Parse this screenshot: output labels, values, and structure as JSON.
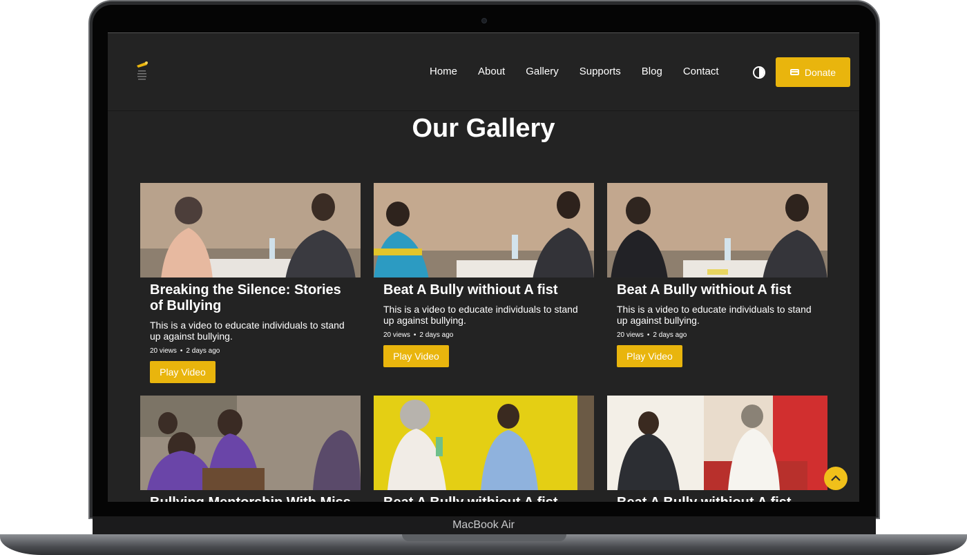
{
  "device": {
    "label": "MacBook Air"
  },
  "nav": {
    "items": [
      "Home",
      "About",
      "Gallery",
      "Supports",
      "Blog",
      "Contact"
    ],
    "donate_label": "Donate"
  },
  "page": {
    "title": "Our Gallery"
  },
  "colors": {
    "accent": "#e9b50d",
    "background": "#232323",
    "text": "#ffffff"
  },
  "videos": [
    {
      "title": "Breaking the Silence: Stories of Bullying",
      "description": "This is a video to educate individuals to stand up against bullying.",
      "views": "20 views",
      "age": "2 days ago",
      "button": "Play Video"
    },
    {
      "title": "Beat A Bully withiout A fist",
      "description": "This is a video to educate individuals to stand up against bullying.",
      "views": "20 views",
      "age": "2 days ago",
      "button": "Play Video"
    },
    {
      "title": "Beat A Bully withiout A fist",
      "description": "This is a video to educate individuals to stand up against bullying.",
      "views": "20 views",
      "age": "2 days ago",
      "button": "Play Video"
    },
    {
      "title": "Bullying Mentorship With Miss"
    },
    {
      "title": "Beat A Bully withiout A fist"
    },
    {
      "title": "Beat A Bully withiout A fist"
    }
  ]
}
